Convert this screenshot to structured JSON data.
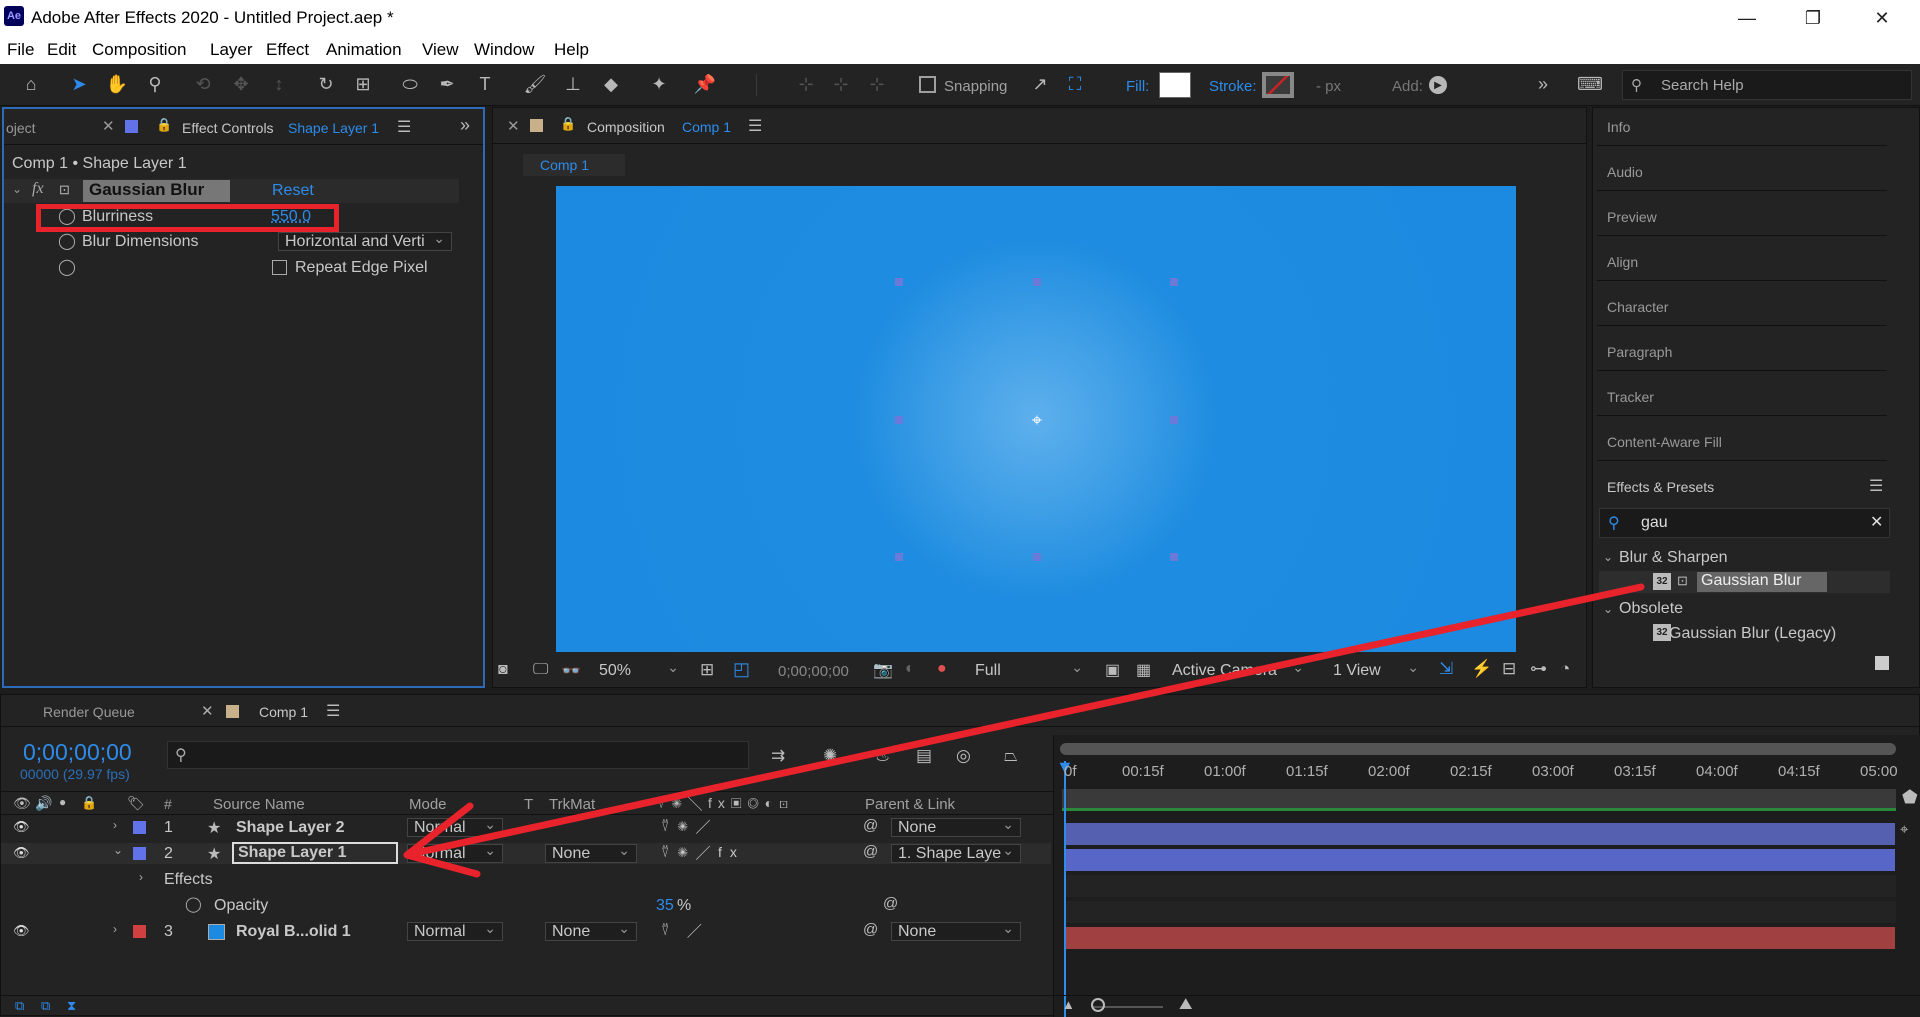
{
  "window": {
    "title": "Adobe After Effects 2020 - Untitled Project.aep *",
    "app_badge": "Ae",
    "minimize": "—",
    "restore": "❐",
    "close": "✕"
  },
  "menu": [
    "File",
    "Edit",
    "Composition",
    "Layer",
    "Effect",
    "Animation",
    "View",
    "Window",
    "Help"
  ],
  "toolbar": {
    "snapping": "Snapping",
    "fill": "Fill:",
    "stroke": "Stroke:",
    "stroke_px": "- px",
    "add": "Add:",
    "search_help": "Search Help",
    "fill_color": "#ffffff",
    "stroke_color": "#d02020"
  },
  "effect_controls": {
    "project_tab": "oject",
    "tab_label": "Effect Controls",
    "tab_layer": "Shape Layer 1",
    "breadcrumb": "Comp 1 • Shape Layer 1",
    "effect_name": "Gaussian Blur",
    "reset": "Reset",
    "fx": "fx",
    "props": {
      "blurriness_label": "Blurriness",
      "blurriness_value": "550.0",
      "dimensions_label": "Blur Dimensions",
      "dimensions_value": "Horizontal and Verti",
      "repeat_edge": "Repeat Edge Pixel"
    }
  },
  "composition": {
    "tab_label": "Composition",
    "tab_comp": "Comp 1",
    "flow_tab": "Comp 1",
    "canvas_color": "#1c8ae0",
    "zoom": "50%",
    "timecode": "0;00;00;00",
    "resolution": "Full",
    "camera": "Active Camera",
    "views": "1 View"
  },
  "right_panel": {
    "items": [
      "Info",
      "Audio",
      "Preview",
      "Align",
      "Character",
      "Paragraph",
      "Tracker",
      "Content-Aware Fill"
    ],
    "effects_presets": "Effects & Presets",
    "search_value": "gau",
    "tree": {
      "group1": "Blur & Sharpen",
      "item1": "Gaussian Blur",
      "group2": "Obsolete",
      "item2": "Gaussian Blur (Legacy)",
      "badge": "32"
    }
  },
  "timeline": {
    "render_queue": "Render Queue",
    "comp_tab": "Comp 1",
    "timecode": "0;00;00;00",
    "frames": "00000 (29.97 fps)",
    "columns": {
      "num": "#",
      "source": "Source Name",
      "mode": "Mode",
      "t": "T",
      "trkmat": "TrkMat",
      "parent": "Parent & Link"
    },
    "ruler": [
      "0f",
      "00:15f",
      "01:00f",
      "01:15f",
      "02:00f",
      "02:15f",
      "03:00f",
      "03:15f",
      "04:00f",
      "04:15f",
      "05:00"
    ],
    "layers": [
      {
        "num": "1",
        "name": "Shape Layer 2",
        "mode": "Normal",
        "trkmat": "",
        "parent": "None",
        "label_color": "#6272e8",
        "bar_color": "#5660b0"
      },
      {
        "num": "2",
        "name": "Shape Layer 1",
        "mode": "Normal",
        "trkmat": "None",
        "parent": "1. Shape Laye",
        "label_color": "#6272e8",
        "bar_color": "#5866c8"
      },
      {
        "num": "3",
        "name": "Royal B...olid 1",
        "mode": "Normal",
        "trkmat": "None",
        "parent": "None",
        "label_color": "#d04040",
        "bar_color": "#a04040"
      }
    ],
    "effects_label": "Effects",
    "opacity_label": "Opacity",
    "opacity_value": "35",
    "opacity_unit": "%"
  },
  "annotations": {
    "color": "#e8232b"
  }
}
